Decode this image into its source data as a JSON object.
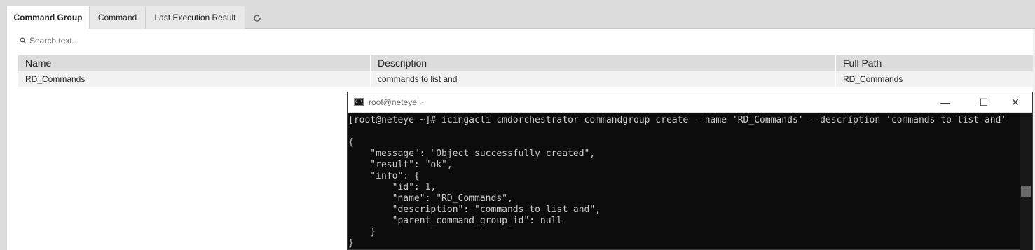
{
  "tabs": [
    {
      "label": "Command Group",
      "active": true
    },
    {
      "label": "Command",
      "active": false
    },
    {
      "label": "Last Execution Result",
      "active": false
    }
  ],
  "refresh_icon": "refresh-icon",
  "search": {
    "placeholder": "Search text...",
    "icon": "search-icon"
  },
  "table": {
    "columns": [
      "Name",
      "Description",
      "Full Path"
    ],
    "rows": [
      {
        "name": "RD_Commands",
        "description": "commands to list and",
        "full_path": "RD_Commands"
      }
    ]
  },
  "terminal": {
    "title": "root@neteye:~",
    "icon": "console-icon",
    "controls": {
      "minimize": "—",
      "maximize": "☐",
      "close": "✕"
    },
    "lines": [
      "[root@neteye ~]# icingacli cmdorchestrator commandgroup create --name 'RD_Commands' --description 'commands to list and'",
      "",
      "{",
      "    \"message\": \"Object successfully created\",",
      "    \"result\": \"ok\",",
      "    \"info\": {",
      "        \"id\": 1,",
      "        \"name\": \"RD_Commands\",",
      "        \"description\": \"commands to list and\",",
      "        \"parent_command_group_id\": null",
      "    }",
      "}"
    ]
  },
  "colors": {
    "tabbar_bg": "#dcdcdc",
    "table_header_bg": "#dcdcdc",
    "row_bg": "#f2f2f2",
    "terminal_bg": "#0c0c0c",
    "terminal_fg": "#cccccc"
  }
}
